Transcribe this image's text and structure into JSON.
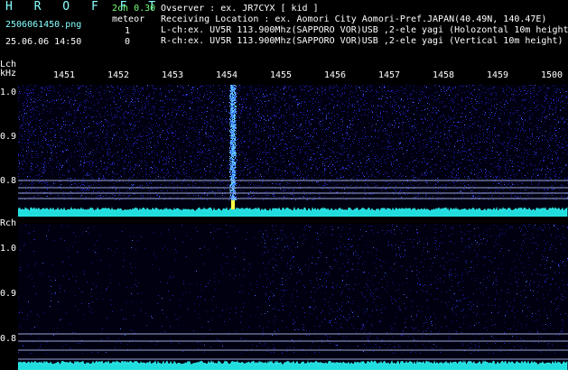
{
  "header": {
    "app_title": "H R O F F T",
    "filename": "2506061450.png",
    "datetime": "25.06.06 14:50",
    "channel_info": "2ch 0.30",
    "meteor_label": "meteor",
    "lch_count": "1",
    "rch_count": "0",
    "observer": "Ovserver               : ex. JR7CYX [ kid ]",
    "location": "Receiving Location : ex. Aomori City Aomori-Pref.JAPAN(40.49N, 140.47E)",
    "lch_desc": "L-ch:ex. UV5R 113.900Mhz(SAPPORO VOR)USB ,2-ele yagi (Holozontal 10m height",
    "rch_desc": "R-ch:ex. UV5R 113.900Mhz(SAPPORO VOR)USB ,2-ele yagi (Vertical 10m height)"
  },
  "left_panel": {
    "name": "Lch",
    "unit": "kHz",
    "y_ticks": [
      "1.0",
      "0.9",
      "0.8"
    ],
    "x_ticks": [
      "1451",
      "1452",
      "1453",
      "1454",
      "1455",
      "1456",
      "1457",
      "1458",
      "1459",
      "1500"
    ]
  },
  "right_panel": {
    "name": "Rch",
    "y_ticks": [
      "1.0",
      "0.9",
      "0.8"
    ]
  },
  "colors": {
    "background": "#000000",
    "noise": "#1a1aa0",
    "signal": "#66ccff",
    "spectrum": "#33ffff",
    "text_cyan": "#88ffff",
    "text_green": "#77ff77"
  }
}
